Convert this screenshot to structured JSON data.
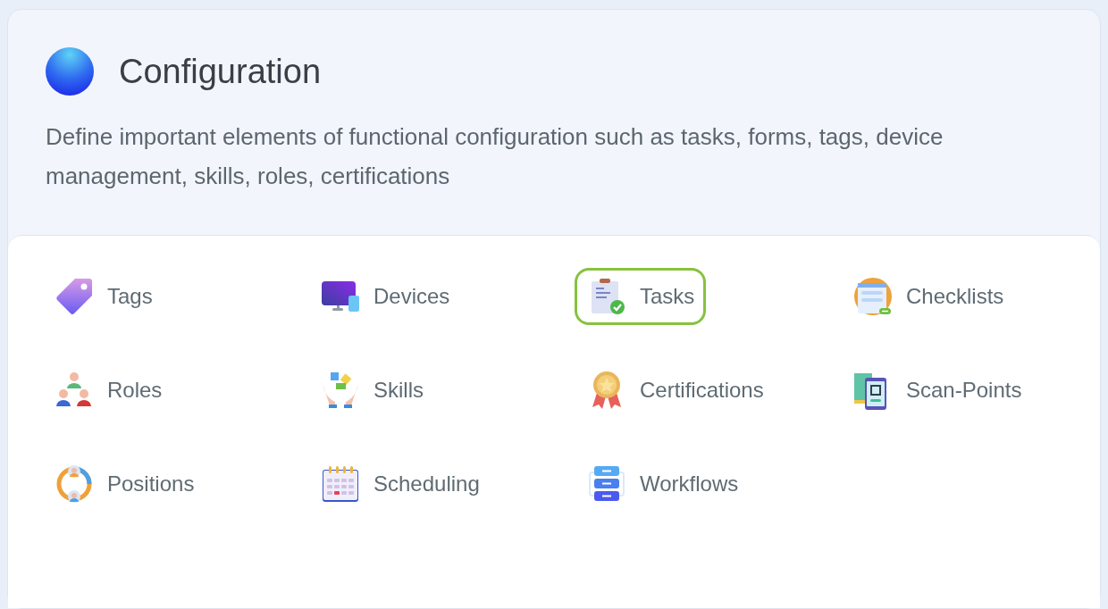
{
  "header": {
    "title": "Configuration",
    "description": "Define important elements of functional configuration such as tasks, forms, tags, device management, skills, roles, certifications"
  },
  "items": [
    {
      "label": "Tags",
      "kind": "tag",
      "selected": false
    },
    {
      "label": "Devices",
      "kind": "devices",
      "selected": false
    },
    {
      "label": "Tasks",
      "kind": "tasks",
      "selected": true
    },
    {
      "label": "Checklists",
      "kind": "checklist",
      "selected": false
    },
    {
      "label": "Roles",
      "kind": "roles",
      "selected": false
    },
    {
      "label": "Skills",
      "kind": "skills",
      "selected": false
    },
    {
      "label": "Certifications",
      "kind": "certification",
      "selected": false
    },
    {
      "label": "Scan-Points",
      "kind": "scan",
      "selected": false
    },
    {
      "label": "Positions",
      "kind": "positions",
      "selected": false
    },
    {
      "label": "Scheduling",
      "kind": "calendar",
      "selected": false
    },
    {
      "label": "Workflows",
      "kind": "workflow",
      "selected": false
    }
  ]
}
